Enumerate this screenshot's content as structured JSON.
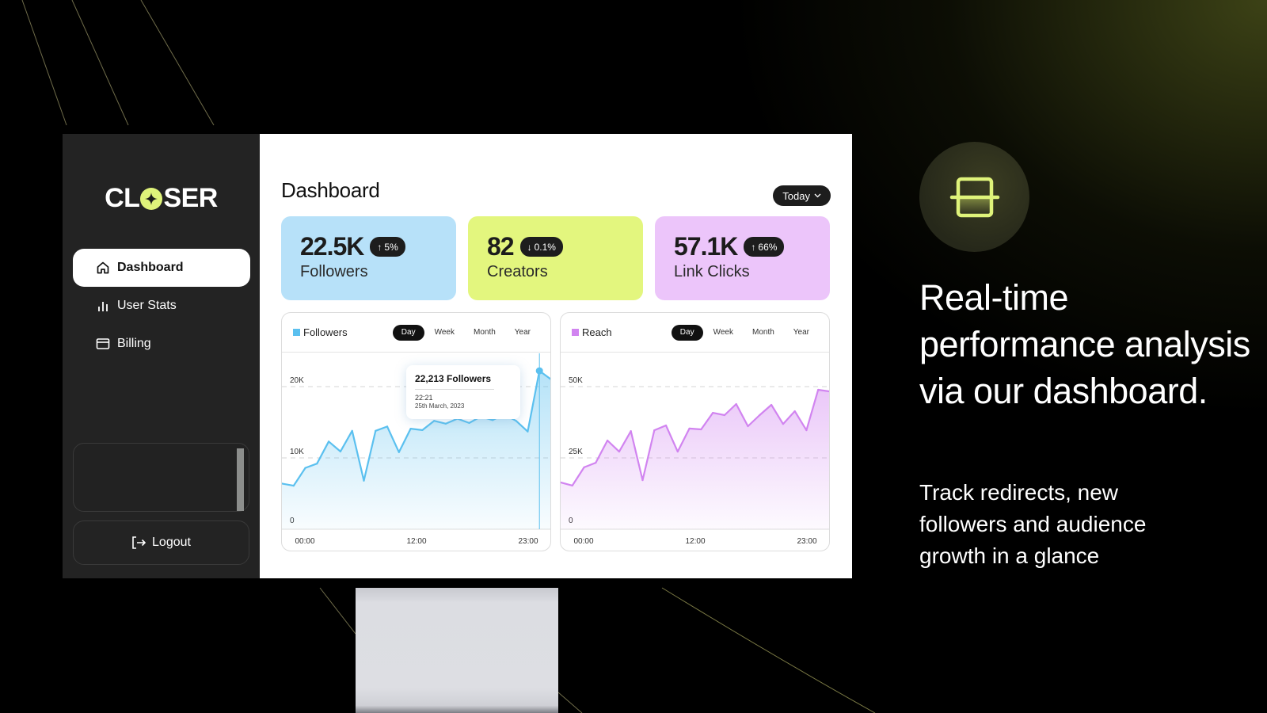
{
  "brand": {
    "name_prefix": "CL",
    "name_suffix": "SER",
    "accent": "#dff37a"
  },
  "sidebar": {
    "items": [
      {
        "label": "Dashboard",
        "icon": "home-icon",
        "active": true
      },
      {
        "label": "User Stats",
        "icon": "bar-chart-icon",
        "active": false
      },
      {
        "label": "Billing",
        "icon": "credit-card-icon",
        "active": false
      }
    ],
    "logout_label": "Logout"
  },
  "header": {
    "title": "Dashboard",
    "range_selector": "Today"
  },
  "stats": [
    {
      "value": "22.5K",
      "change": "5%",
      "direction": "up",
      "label": "Followers",
      "color": "#b7e1f9"
    },
    {
      "value": "82",
      "change": "0.1%",
      "direction": "down",
      "label": "Creators",
      "color": "#e3f67e"
    },
    {
      "value": "57.1K",
      "change": "66%",
      "direction": "up",
      "label": "Link Clicks",
      "color": "#ecc5fa"
    }
  ],
  "periods": [
    "Day",
    "Week",
    "Month",
    "Year"
  ],
  "tooltip": {
    "title": "22,213 Followers",
    "time": "22:21",
    "date": "25th March, 2023"
  },
  "chart_data": [
    {
      "type": "area",
      "title": "Followers",
      "color": "#5bc0ef",
      "active_period": "Day",
      "x_ticks": [
        "00:00",
        "12:00",
        "23:00"
      ],
      "y_ticks": [
        "0",
        "10K",
        "20K"
      ],
      "ylim": [
        0,
        24000
      ],
      "values": [
        6400,
        6100,
        8600,
        9200,
        12300,
        10900,
        13800,
        6800,
        13800,
        14400,
        10800,
        14100,
        13900,
        15200,
        14800,
        15500,
        14900,
        15800,
        15300,
        16100,
        15200,
        13700,
        22213,
        21000
      ],
      "highlight_index": 22
    },
    {
      "type": "area",
      "title": "Reach",
      "color": "#d184f0",
      "active_period": "Day",
      "x_ticks": [
        "00:00",
        "12:00",
        "23:00"
      ],
      "y_ticks": [
        "0",
        "25K",
        "50K"
      ],
      "ylim": [
        0,
        60000
      ],
      "values": [
        16400,
        15300,
        21700,
        23300,
        31100,
        27200,
        34400,
        17200,
        34700,
        36400,
        27200,
        35300,
        35000,
        40800,
        40000,
        43900,
        36100,
        40000,
        43600,
        36900,
        41400,
        34700,
        48900,
        48300
      ]
    }
  ],
  "promo": {
    "headline": "Real-time performance analysis via our dashboard.",
    "subline": "Track redirects, new followers and audience growth in a glance"
  }
}
